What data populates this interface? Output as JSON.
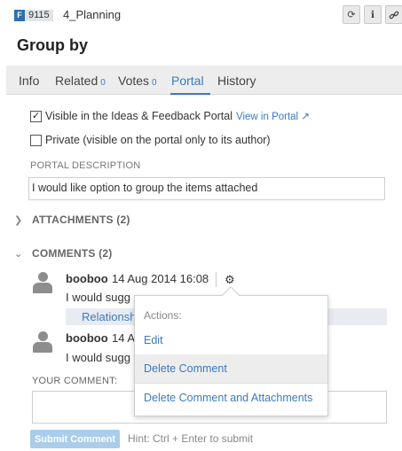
{
  "header": {
    "type_letter": "F",
    "id_number": "9115",
    "release": "4_Planning",
    "title": "Group by",
    "tools": [
      {
        "icon": "refresh-icon",
        "glyph": "⟳"
      },
      {
        "icon": "info-icon",
        "glyph": "ℹ"
      },
      {
        "icon": "link-icon",
        "glyph": "🔗"
      }
    ]
  },
  "tabs": [
    {
      "label": "Info",
      "count": ""
    },
    {
      "label": "Related",
      "count": "0"
    },
    {
      "label": "Votes",
      "count": "0"
    },
    {
      "label": "Portal",
      "count": "",
      "active": true
    },
    {
      "label": "History",
      "count": ""
    }
  ],
  "portal": {
    "visible_label": "Visible in the Ideas & Feedback Portal",
    "visible_checked": true,
    "view_link": "View in Portal",
    "private_label": "Private (visible on the portal only to its author)",
    "private_checked": false,
    "description_label": "PORTAL DESCRIPTION",
    "description_value": "I would like option to group the items attached"
  },
  "attachments": {
    "label": "ATTACHMENTS (2)"
  },
  "comments": {
    "label": "COMMENTS (2)",
    "items": [
      {
        "author": "booboo",
        "date": "14 Aug 2014 16:08",
        "text": "I would sugg",
        "relation_text": "Relationsh"
      },
      {
        "author": "booboo",
        "date": "14 A",
        "text": "I would sugg"
      }
    ],
    "your_comment_label": "YOUR COMMENT:",
    "submit_label": "Submit Comment",
    "hint": "Hint: Ctrl + Enter to submit"
  },
  "actions_menu": {
    "title": "Actions:",
    "items": [
      "Edit",
      "Delete Comment",
      "Delete Comment and Attachments"
    ]
  },
  "colors": {
    "accent": "#3b7ac0",
    "badge": "#2f6fb0",
    "submit_disabled": "#a9cdea"
  }
}
